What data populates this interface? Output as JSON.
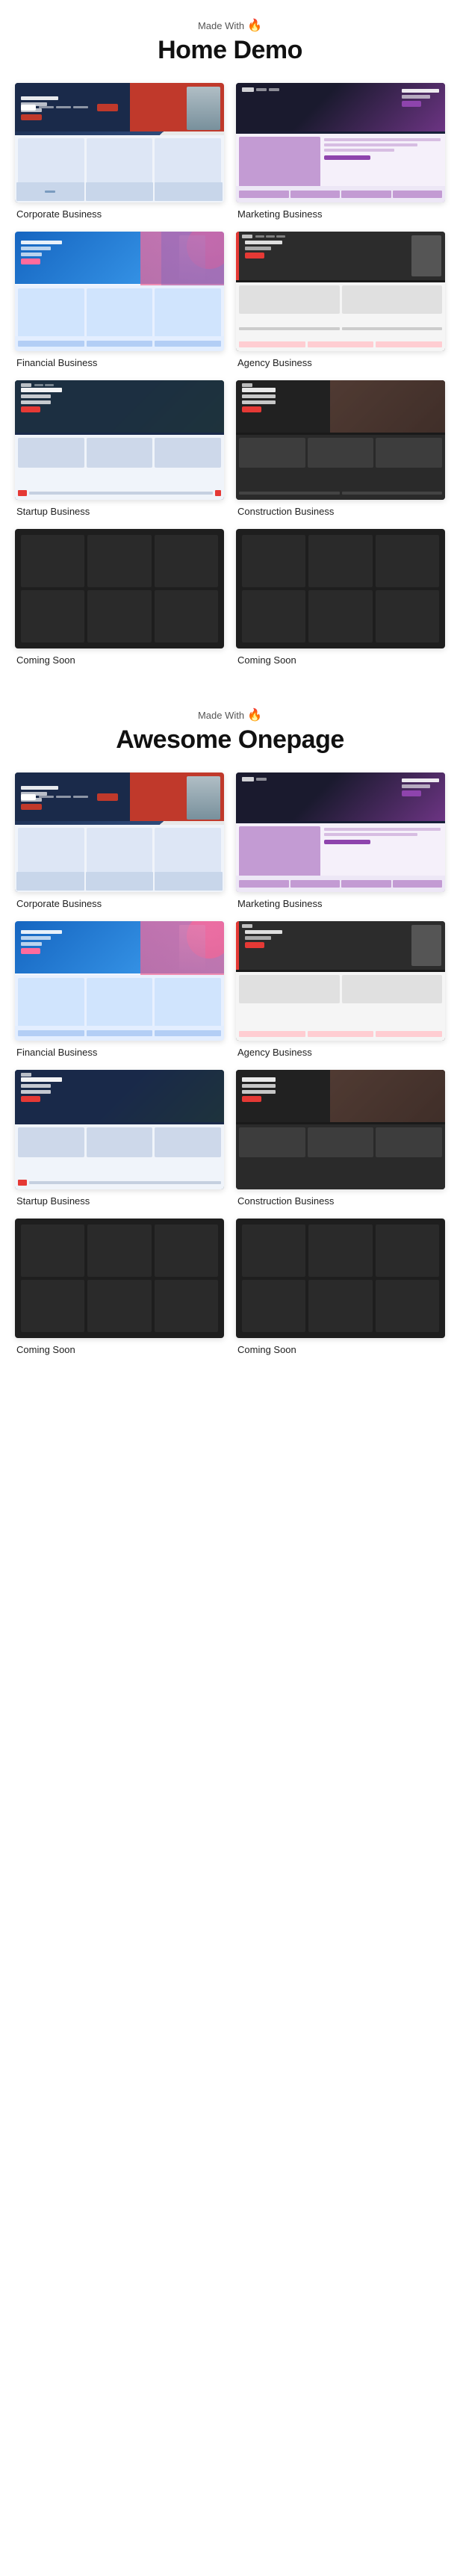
{
  "homedemo": {
    "made_with": "Made With",
    "title": "Home Demo",
    "items": [
      {
        "id": "corporate-1",
        "label": "Corporate Business"
      },
      {
        "id": "marketing-1",
        "label": "Marketing Business"
      },
      {
        "id": "financial-1",
        "label": "Financial Business"
      },
      {
        "id": "agency-1",
        "label": "Agency Business"
      },
      {
        "id": "startup-1",
        "label": "Startup Business"
      },
      {
        "id": "construction-1",
        "label": "Construction Business"
      },
      {
        "id": "coming-soon-1",
        "label": "Coming Soon"
      },
      {
        "id": "coming-soon-2",
        "label": "Coming Soon"
      }
    ]
  },
  "onepage": {
    "made_with": "Made With",
    "title": "Awesome Onepage",
    "items": [
      {
        "id": "corporate-op",
        "label": "Corporate Business"
      },
      {
        "id": "marketing-op",
        "label": "Marketing Business"
      },
      {
        "id": "financial-op",
        "label": "Financial Business"
      },
      {
        "id": "agency-op",
        "label": "Agency Business"
      },
      {
        "id": "startup-op",
        "label": "Startup Business"
      },
      {
        "id": "construction-op",
        "label": "Construction Business"
      },
      {
        "id": "coming-soon-op-1",
        "label": "Coming Soon"
      },
      {
        "id": "coming-soon-op-2",
        "label": "Coming Soon"
      }
    ]
  }
}
